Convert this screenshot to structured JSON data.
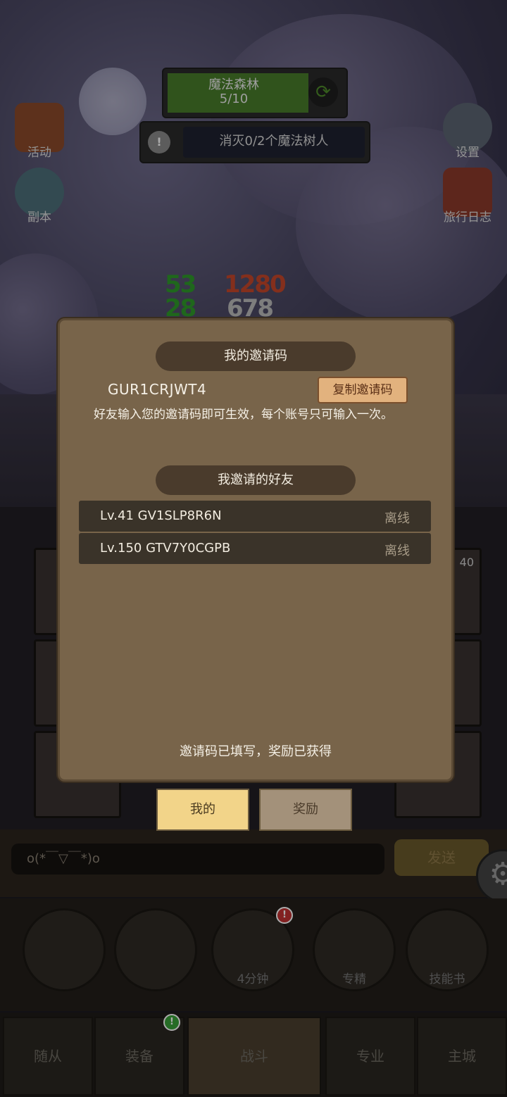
{
  "hud": {
    "stage_name": "魔法森林",
    "stage_progress": "5/10",
    "quest_text": "消灭0/2个魔法树人",
    "left_icons": [
      "活动",
      "副本"
    ],
    "right_icons": [
      "设置",
      "旅行日志"
    ],
    "damage_numbers": [
      "53",
      "28",
      "1280",
      "678"
    ]
  },
  "modal": {
    "invite_header": "我的邀请码",
    "invite_code": "GUR1CRJWT4",
    "copy_button": "复制邀请码",
    "description": "好友输入您的邀请码即可生效，每个账号只可输入一次。",
    "friends_header": "我邀请的好友",
    "friends": [
      {
        "name": "Lv.41 GV1SLP8R6N",
        "status": "离线"
      },
      {
        "name": "Lv.150 GTV7Y0CGPB",
        "status": "离线"
      }
    ],
    "footer_text": "邀请码已填写，奖励已获得"
  },
  "tabs": {
    "mine": "我的",
    "rewards": "奖励"
  },
  "chat": {
    "input_value": "o(*￣▽￣*)o",
    "send_label": "发送"
  },
  "actions": [
    {
      "label": ""
    },
    {
      "label": ""
    },
    {
      "label": "4分钟"
    },
    {
      "label": "专精"
    },
    {
      "label": "技能书"
    }
  ],
  "nav": [
    "随从",
    "装备",
    "战斗",
    "专业",
    "主城"
  ],
  "card_count": "40"
}
